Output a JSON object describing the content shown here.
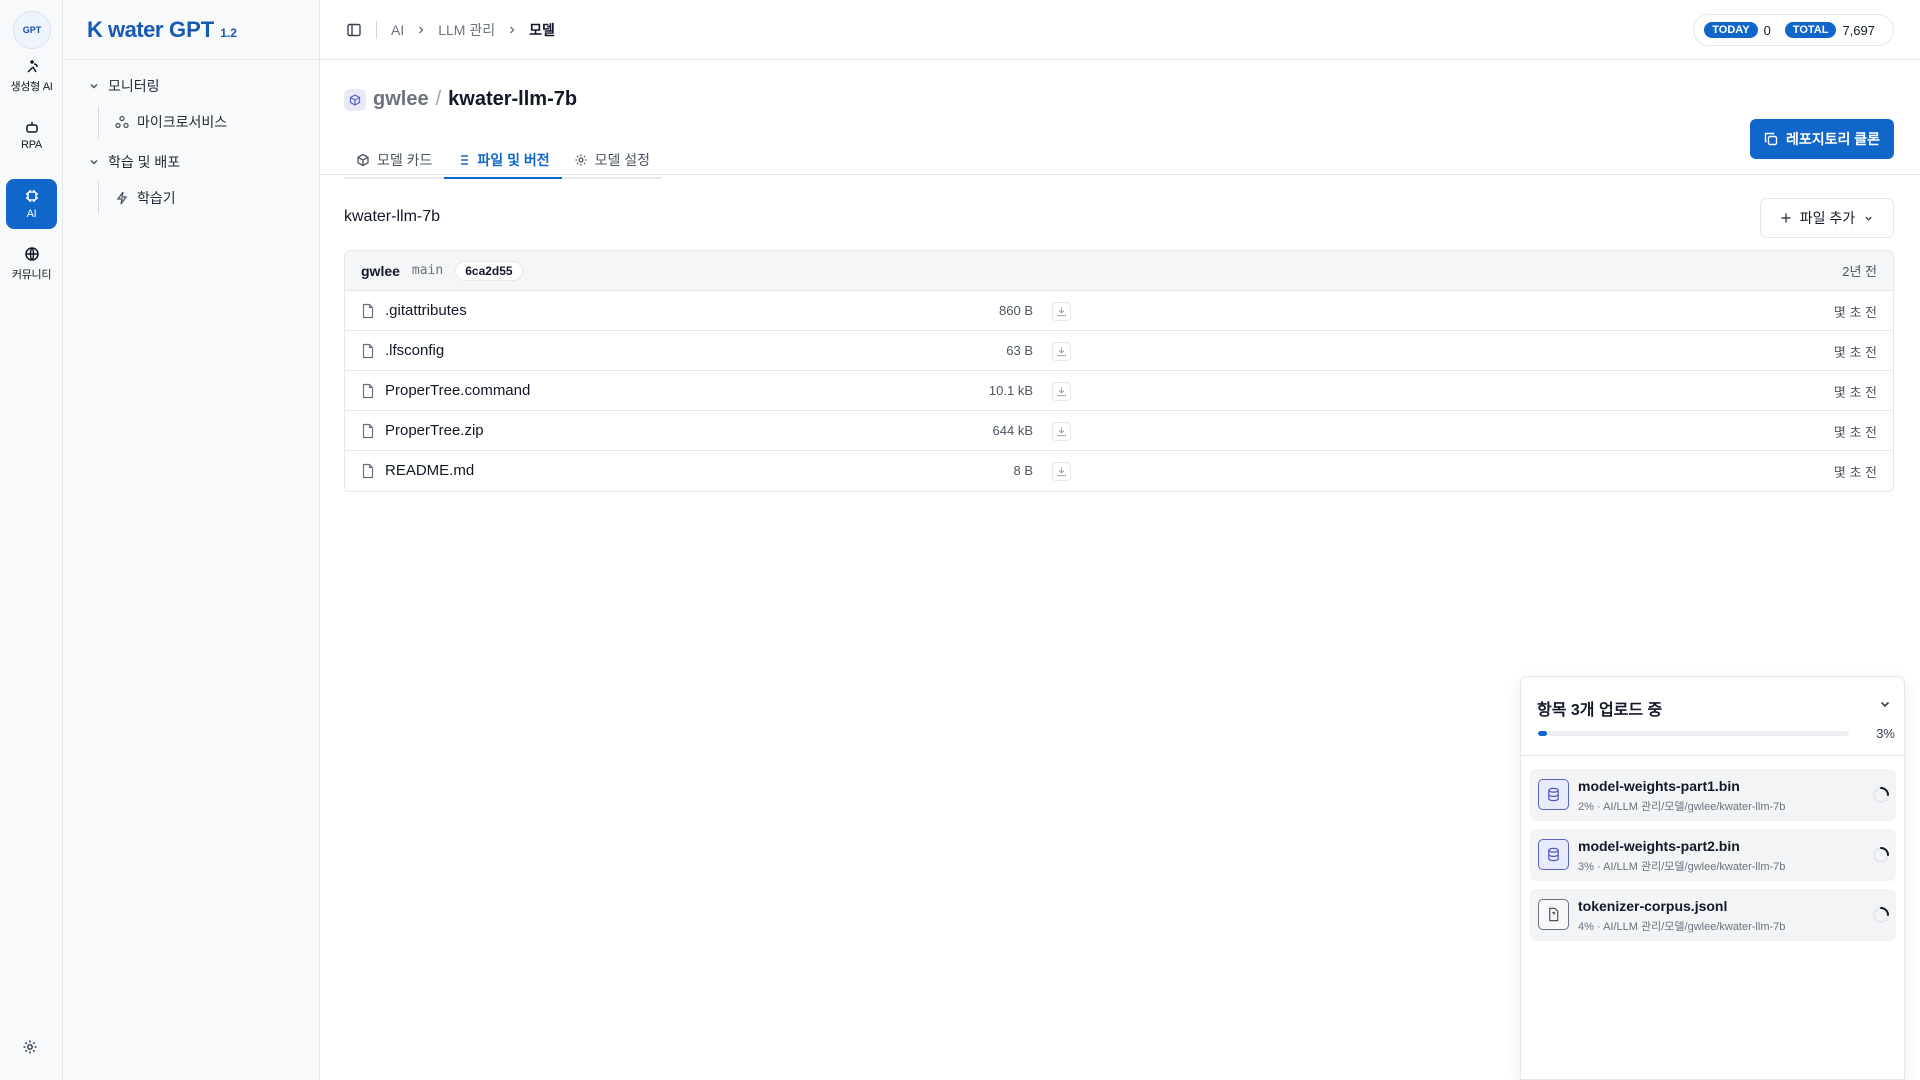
{
  "rail": {
    "logo_text": "GPT",
    "items": [
      {
        "label": "생성형 AI",
        "icon": "sparkle-icon",
        "active": false
      },
      {
        "label": "RPA",
        "icon": "robot-icon",
        "active": false
      },
      {
        "label": "AI",
        "icon": "chip-icon",
        "active": true
      },
      {
        "label": "커뮤니티",
        "icon": "globe-icon",
        "active": false
      }
    ]
  },
  "brand": {
    "name": "K water",
    "product": "GPT",
    "version": "1.2"
  },
  "sidebar": {
    "groups": [
      {
        "label": "모니터링",
        "children": [
          {
            "label": "마이크로서비스",
            "icon": "services-icon"
          }
        ]
      },
      {
        "label": "학습 및 배포",
        "children": [
          {
            "label": "학습기",
            "icon": "bolt-icon"
          }
        ]
      }
    ]
  },
  "breadcrumb": {
    "items": [
      "AI",
      "LLM 관리",
      "모델"
    ]
  },
  "stats": {
    "today_label": "TODAY",
    "today_value": "0",
    "total_label": "TOTAL",
    "total_value": "7,697"
  },
  "repo": {
    "owner": "gwlee",
    "separator": "/",
    "name": "kwater-llm-7b",
    "clone_label": "레포지토리 클론"
  },
  "tabs": [
    {
      "label": "모델 카드",
      "icon": "cube-icon",
      "active": false
    },
    {
      "label": "파일 및 버전",
      "icon": "list-icon",
      "active": true
    },
    {
      "label": "모델 설정",
      "icon": "gear-icon",
      "active": false
    }
  ],
  "files": {
    "path_label": "kwater-llm-7b",
    "add_label": "파일 추가",
    "head": {
      "owner": "gwlee",
      "branch": "main",
      "commit": "6ca2d55",
      "time": "2년 전"
    },
    "rows": [
      {
        "name": ".gitattributes",
        "size": "860 B",
        "ago": "몇 초 전"
      },
      {
        "name": ".lfsconfig",
        "size": "63 B",
        "ago": "몇 초 전"
      },
      {
        "name": "ProperTree.command",
        "size": "10.1 kB",
        "ago": "몇 초 전"
      },
      {
        "name": "ProperTree.zip",
        "size": "644 kB",
        "ago": "몇 초 전"
      },
      {
        "name": "README.md",
        "size": "8 B",
        "ago": "몇 초 전"
      }
    ]
  },
  "upload": {
    "title": "항목 3개 업로드 중",
    "percent_label": "3%",
    "progress": 0.03,
    "items": [
      {
        "name": "model-weights-part1.bin",
        "pct": "2%",
        "path": "AI/LLM 관리/모델/gwlee/kwater-llm-7b",
        "icon": "database-icon"
      },
      {
        "name": "model-weights-part2.bin",
        "pct": "3%",
        "path": "AI/LLM 관리/모델/gwlee/kwater-llm-7b",
        "icon": "database-icon"
      },
      {
        "name": "tokenizer-corpus.jsonl",
        "pct": "4%",
        "path": "AI/LLM 관리/모델/gwlee/kwater-llm-7b",
        "icon": "document-icon"
      }
    ]
  },
  "colors": {
    "accent": "#1166c9",
    "border": "#e5e7eb",
    "rail_bg": "#f8f9fb"
  }
}
